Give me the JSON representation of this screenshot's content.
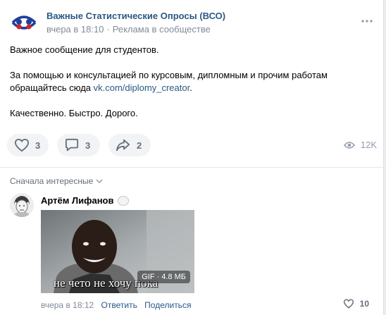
{
  "post": {
    "author": "Важные Статистические Опросы (ВСО)",
    "time": "вчера в 18:10",
    "separator": "·",
    "label": "Реклама в сообществе",
    "more_icon": "ellipsis-icon",
    "text": {
      "line1": "Важное сообщение для студентов.",
      "line2_prefix": "За помощью и консультацией по курсовым, дипломным и прочим работам обращайтесь сюда ",
      "link": "vk.com/diplomy_creator",
      "line2_suffix": ".",
      "line3": "Качественно. Быстро. Дорого."
    },
    "actions": {
      "likes": "3",
      "comments": "3",
      "shares": "2",
      "views": "12K"
    }
  },
  "comments": {
    "sort_label": "Сначала интересные",
    "items": [
      {
        "author": "Артём Лифанов",
        "gif_caption": "не чето не хочу пока",
        "gif_type": "GIF",
        "gif_size": "4.8 МБ",
        "time": "вчера в 18:12",
        "reply": "Ответить",
        "share": "Поделиться",
        "likes": "10"
      }
    ]
  },
  "colors": {
    "link": "#2a5885",
    "muted": "#818c99",
    "pill_bg": "#f2f3f5",
    "logo_blue": "#1f3f9a",
    "logo_red": "#d22626"
  }
}
